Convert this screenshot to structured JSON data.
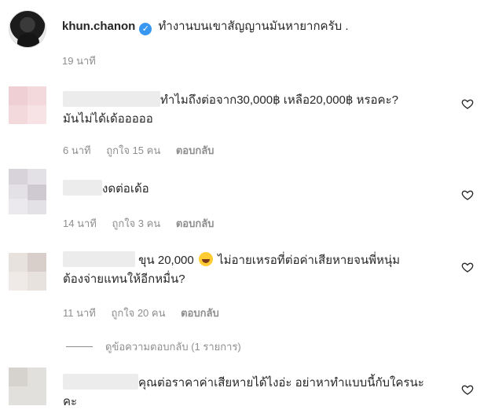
{
  "post": {
    "username": "khun.chanon",
    "caption": "ทำงานบนเขาสัญญานมันหายากครับ .",
    "time": "19 นาที"
  },
  "comments": [
    {
      "text_line1": "ทำไมถึงต่อจาก30,000฿ เหลือ20,000฿ หรอคะ?",
      "text_line2": "มันไม่ได้เด้อออออ",
      "time": "6 นาที",
      "likes": "ถูกใจ 15 คน",
      "reply": "ตอบกลับ"
    },
    {
      "text_line1": "งดต่อเด้อ",
      "time": "14 นาที",
      "likes": "ถูกใจ 3 คน",
      "reply": "ตอบกลับ"
    },
    {
      "text_a": "ขุน 20,000",
      "text_b": "ไม่อายเหรอที่ต่อค่าเสียหายจนพี่หนุ่ม",
      "text_line2": "ต้องจ่ายแทนให้อีกหมื่น?",
      "time": "11 นาที",
      "likes": "ถูกใจ 20 คน",
      "reply": "ตอบกลับ"
    },
    {
      "text_line1": "คุณต่อราคาค่าเสียหายได้ไงอ่ะ อย่าหาทำแบบนี้กับใครนะ",
      "text_line2": "คะ"
    }
  ],
  "view_replies": "ดูข้อความตอบกลับ (1 รายการ)",
  "icons": {
    "like": "heart-outline-icon",
    "verified": "verified-badge-icon",
    "emoji": "laughing-emoji-icon"
  },
  "colors": {
    "text": "#262626",
    "muted": "#8e8e8e",
    "verified": "#3897f0"
  }
}
